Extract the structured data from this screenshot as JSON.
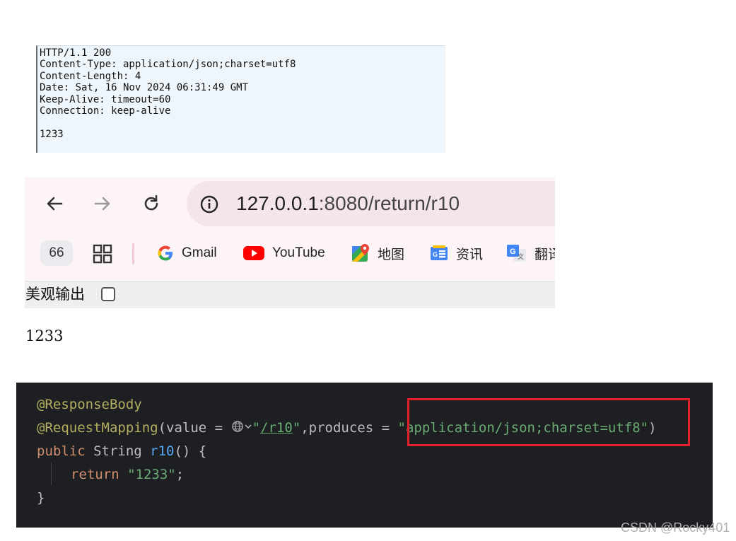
{
  "http_response": {
    "lines": [
      "HTTP/1.1 200",
      "Content-Type: application/json;charset=utf8",
      "Content-Length: 4",
      "Date: Sat, 16 Nov 2024 06:31:49 GMT",
      "Keep-Alive: timeout=60",
      "Connection: keep-alive",
      "",
      "1233"
    ]
  },
  "browser": {
    "url_host": "127.0.0.1",
    "url_rest": ":8080/return/r10",
    "tab_count": "66",
    "bookmarks": [
      {
        "label": "Gmail",
        "icon": "google-icon"
      },
      {
        "label": "YouTube",
        "icon": "youtube-icon"
      },
      {
        "label": "地图",
        "icon": "maps-icon"
      },
      {
        "label": "资讯",
        "icon": "news-icon"
      },
      {
        "label": "翻译",
        "icon": "translate-icon"
      }
    ],
    "pretty_print_label": "美观输出",
    "pretty_print_checked": false
  },
  "response_body": "1233",
  "code": {
    "annotation1": "@ResponseBody",
    "annotation2": "@RequestMapping",
    "paren_open": "(",
    "param_value": "value = ",
    "value_quote_open": "\"",
    "value_path": "/r10",
    "value_quote_close": "\"",
    "param_produces": ",produces = ",
    "produces_value": "\"application/json;charset=utf8\"",
    "paren_close": ")",
    "kw_public": "public",
    "type_string": " String ",
    "method_name": "r10",
    "method_sig_rest": "() {",
    "kw_return": "return",
    "return_value": "\"1233\"",
    "semicolon": ";",
    "closing_brace": "}"
  },
  "watermark": "CSDN @Rocky401",
  "colors": {
    "highlight_border": "#e0202a",
    "code_background": "#1e1f22",
    "string_green": "#6aab73",
    "keyword_orange": "#cf8e6d",
    "annotation_yellow": "#b3ae60",
    "function_blue": "#56a8f5"
  }
}
